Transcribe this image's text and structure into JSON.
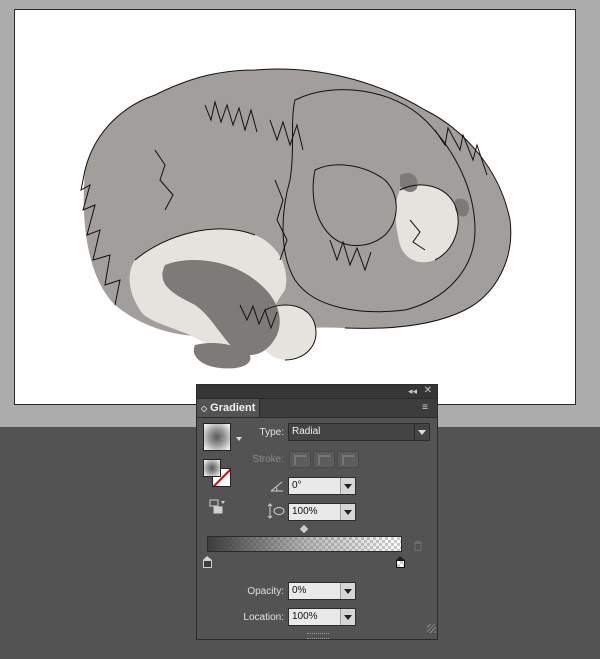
{
  "panel": {
    "tab_label": "Gradient",
    "tab_arrows": "◇",
    "collapse_glyph": "◂◂",
    "close_glyph": "✕",
    "menu_glyph": "≡",
    "type_label": "Type:",
    "type_value": "Radial",
    "stroke_label": "Stroke:",
    "angle_value": "0°",
    "aspect_value": "100%",
    "opacity_label": "Opacity:",
    "opacity_value": "0%",
    "location_label": "Location:",
    "location_value": "100%"
  },
  "icons": {
    "angle": "angle-icon",
    "aspect": "aspect-ratio-icon",
    "reverse": "reverse-gradient-icon",
    "delete_stop": "trash-icon"
  },
  "colors": {
    "cat_body": "#a29e9b",
    "cat_light": "#e6e3df",
    "cat_dark": "#7e7a77",
    "panel_bg": "#535353",
    "pasteboard": "#acacac"
  }
}
